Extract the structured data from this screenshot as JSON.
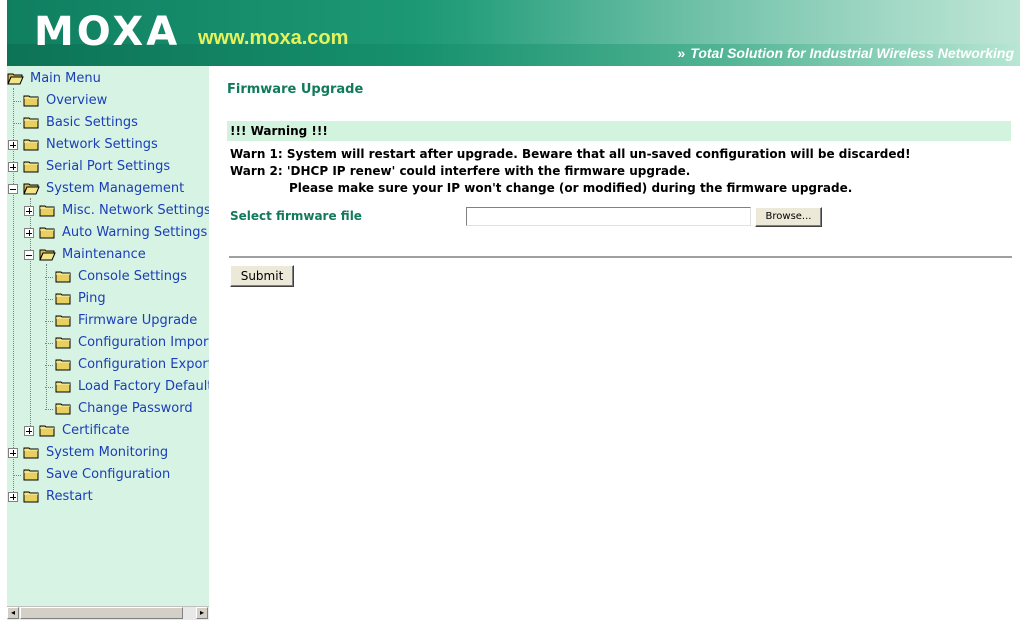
{
  "header": {
    "logo": "MOXA",
    "url": "www.moxa.com",
    "tagline_prefix": "»",
    "tagline": "Total Solution for Industrial Wireless Networking"
  },
  "sidebar": {
    "items": [
      {
        "label": "Main Menu"
      },
      {
        "label": "Overview"
      },
      {
        "label": "Basic Settings"
      },
      {
        "label": "Network Settings"
      },
      {
        "label": "Serial Port Settings"
      },
      {
        "label": "System Management"
      },
      {
        "label": "Misc. Network Settings"
      },
      {
        "label": "Auto Warning Settings"
      },
      {
        "label": "Maintenance"
      },
      {
        "label": "Console Settings"
      },
      {
        "label": "Ping"
      },
      {
        "label": "Firmware Upgrade"
      },
      {
        "label": "Configuration Import"
      },
      {
        "label": "Configuration Export"
      },
      {
        "label": "Load Factory Default"
      },
      {
        "label": "Change Password"
      },
      {
        "label": "Certificate"
      },
      {
        "label": "System Monitoring"
      },
      {
        "label": "Save Configuration"
      },
      {
        "label": "Restart"
      }
    ]
  },
  "main": {
    "title": "Firmware Upgrade",
    "warning_title": "!!! Warning !!!",
    "warn1": "Warn 1: System will restart after upgrade. Beware that all un-saved configuration will be discarded!",
    "warn2": "Warn 2: 'DHCP IP renew' could interfere with the firmware upgrade.",
    "warn2_cont": "Please make sure your IP won't change (or modified) during the firmware upgrade.",
    "select_label": "Select firmware file",
    "file_value": "",
    "browse_label": "Browse...",
    "submit_label": "Submit"
  },
  "colors": {
    "sidebar_bg": "#d7f3e3",
    "link": "#1a3fb8",
    "accent_green": "#117a5a",
    "header_green": "#1a8a6b",
    "url_yellow": "#e6f25a"
  },
  "icons": {
    "folder": "folder-icon",
    "folder_open": "folder-open-icon",
    "expand": "plus-box-icon",
    "collapse": "minus-box-icon"
  }
}
